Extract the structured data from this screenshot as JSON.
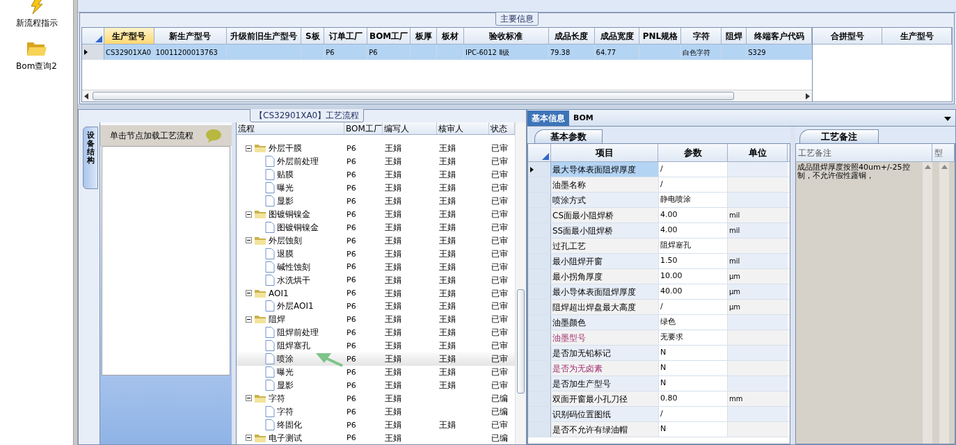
{
  "launcher": [
    {
      "kind": "bolt",
      "label": "新流程指示"
    },
    {
      "kind": "folder",
      "label": "Bom查询2"
    }
  ],
  "main_info": {
    "title": "主要信息",
    "columns": [
      {
        "label": "生产型号",
        "selected": true
      },
      {
        "label": "新生产型号",
        "selected": false
      },
      {
        "label": "升级前旧生产型号",
        "selected": false
      },
      {
        "label": "S板",
        "selected": false
      },
      {
        "label": "订单工厂",
        "selected": false
      },
      {
        "label": "BOM工厂",
        "selected": false
      },
      {
        "label": "板厚",
        "selected": false
      },
      {
        "label": "板材",
        "selected": false
      },
      {
        "label": "验收标准",
        "selected": false
      },
      {
        "label": "成品长度",
        "selected": false
      },
      {
        "label": "成品宽度",
        "selected": false
      },
      {
        "label": "PNL规格",
        "selected": false
      },
      {
        "label": "字符",
        "selected": false
      },
      {
        "label": "阻焊",
        "selected": false
      },
      {
        "label": "终端客户代码",
        "selected": false
      }
    ],
    "rows": [
      {
        "selected": true,
        "cells": [
          "CS32901XA0",
          "10011200013763",
          "",
          "",
          "P6",
          "P6",
          "",
          "",
          "IPC-6012 Ⅱ级",
          "79.38",
          "64.77",
          "",
          "白色字符",
          "",
          "S329"
        ]
      }
    ],
    "side_columns": [
      "合拼型号",
      "生产型号"
    ]
  },
  "process": {
    "title": "【CS32901XA0】工艺流程",
    "side_tab": "设备结构",
    "hint": "单击节点加载工艺流程",
    "columns": [
      "流程",
      "BOM工厂",
      "编写人",
      "核审人",
      "状态"
    ],
    "tree": [
      {
        "label": "外层干膜",
        "bom": "P6",
        "writer": "王娟",
        "reviewer": "王娟",
        "status": "已审",
        "expanded": true,
        "selected": false,
        "children": [
          {
            "label": "外层前处理",
            "bom": "P6",
            "writer": "王娟",
            "reviewer": "王娟",
            "status": "已审",
            "selected": false
          },
          {
            "label": "贴膜",
            "bom": "P6",
            "writer": "王娟",
            "reviewer": "王娟",
            "status": "已审",
            "selected": false
          },
          {
            "label": "曝光",
            "bom": "P6",
            "writer": "王娟",
            "reviewer": "王娟",
            "status": "已审",
            "selected": false
          },
          {
            "label": "显影",
            "bom": "P6",
            "writer": "王娟",
            "reviewer": "王娟",
            "status": "已审",
            "selected": false
          }
        ]
      },
      {
        "label": "图镀铜镍金",
        "bom": "P6",
        "writer": "王娟",
        "reviewer": "王娟",
        "status": "已审",
        "expanded": true,
        "selected": false,
        "children": [
          {
            "label": "图镀铜镍金",
            "bom": "P6",
            "writer": "王娟",
            "reviewer": "王娟",
            "status": "已审",
            "selected": false
          }
        ]
      },
      {
        "label": "外层蚀刻",
        "bom": "P6",
        "writer": "王娟",
        "reviewer": "王娟",
        "status": "已审",
        "expanded": true,
        "selected": false,
        "children": [
          {
            "label": "退膜",
            "bom": "P6",
            "writer": "王娟",
            "reviewer": "王娟",
            "status": "已审",
            "selected": false
          },
          {
            "label": "碱性蚀刻",
            "bom": "P6",
            "writer": "王娟",
            "reviewer": "王娟",
            "status": "已审",
            "selected": false
          },
          {
            "label": "水洗烘干",
            "bom": "P6",
            "writer": "王娟",
            "reviewer": "王娟",
            "status": "已审",
            "selected": false
          }
        ]
      },
      {
        "label": "AOI1",
        "bom": "P6",
        "writer": "王娟",
        "reviewer": "王娟",
        "status": "已审",
        "expanded": true,
        "selected": false,
        "children": [
          {
            "label": "外层AOI1",
            "bom": "P6",
            "writer": "王娟",
            "reviewer": "王娟",
            "status": "已审",
            "selected": false
          }
        ]
      },
      {
        "label": "阻焊",
        "bom": "P6",
        "writer": "王娟",
        "reviewer": "王娟",
        "status": "已审",
        "expanded": true,
        "selected": false,
        "children": [
          {
            "label": "阻焊前处理",
            "bom": "P6",
            "writer": "王娟",
            "reviewer": "王娟",
            "status": "已审",
            "selected": false
          },
          {
            "label": "阻焊塞孔",
            "bom": "P6",
            "writer": "王娟",
            "reviewer": "王娟",
            "status": "已审",
            "selected": false
          },
          {
            "label": "喷涂",
            "bom": "P6",
            "writer": "王娟",
            "reviewer": "王娟",
            "status": "已审",
            "selected": true
          },
          {
            "label": "曝光",
            "bom": "P6",
            "writer": "王娟",
            "reviewer": "王娟",
            "status": "已审",
            "selected": false
          },
          {
            "label": "显影",
            "bom": "P6",
            "writer": "王娟",
            "reviewer": "王娟",
            "status": "已审",
            "selected": false
          }
        ]
      },
      {
        "label": "字符",
        "bom": "P6",
        "writer": "王娟",
        "status": "已编",
        "expanded": true,
        "selected": false,
        "children": [
          {
            "label": "字符",
            "bom": "P6",
            "writer": "王娟",
            "status": "已编",
            "selected": false
          },
          {
            "label": "终固化",
            "bom": "P6",
            "writer": "王娟",
            "reviewer": "王娟",
            "status": "已审",
            "selected": false
          }
        ]
      },
      {
        "label": "电子测试",
        "bom": "P6",
        "writer": "王娟",
        "status": "已编",
        "expanded": true,
        "selected": false
      }
    ]
  },
  "detail": {
    "tabs": [
      {
        "label": "基本信息",
        "selected": true
      },
      {
        "label": "BOM",
        "selected": false
      }
    ],
    "params_tab": "基本参数",
    "columns": [
      "项目",
      "参数",
      "单位"
    ],
    "params": [
      {
        "item": "最大导体表面阻焊厚度",
        "value": "/",
        "selected": true,
        "kind": "normal"
      },
      {
        "item": "油墨名称",
        "value": "/",
        "selected": false,
        "kind": "normal"
      },
      {
        "item": "喷涂方式",
        "value": "静电喷涂",
        "selected": false,
        "kind": "normal"
      },
      {
        "item": "CS面最小阻焊桥",
        "value": "4.00",
        "unit": "mil",
        "selected": false,
        "kind": "normal"
      },
      {
        "item": "SS面最小阻焊桥",
        "value": "4.00",
        "unit": "mil",
        "selected": false,
        "kind": "normal"
      },
      {
        "item": "过孔工艺",
        "value": "阻焊塞孔",
        "selected": false,
        "kind": "normal"
      },
      {
        "item": "最小阻焊开窗",
        "value": "1.50",
        "unit": "mil",
        "selected": false,
        "kind": "normal"
      },
      {
        "item": "最小拐角厚度",
        "value": "10.00",
        "unit": "μm",
        "selected": false,
        "kind": "normal"
      },
      {
        "item": "最小导体表面阻焊厚度",
        "value": "40.00",
        "unit": "μm",
        "selected": false,
        "kind": "normal"
      },
      {
        "item": "阻焊超出焊盘最大高度",
        "value": "/",
        "unit": "μm",
        "selected": false,
        "kind": "normal"
      },
      {
        "item": "油墨颜色",
        "value": "绿色",
        "selected": false,
        "kind": "normal"
      },
      {
        "item": "油墨型号",
        "value": "无要求",
        "selected": false,
        "kind": "special"
      },
      {
        "item": "是否加无铅标记",
        "value": "N",
        "selected": false,
        "kind": "normal"
      },
      {
        "item": "是否为无卤素",
        "value": "N",
        "selected": false,
        "kind": "special"
      },
      {
        "item": "是否加生产型号",
        "value": "N",
        "selected": false,
        "kind": "normal"
      },
      {
        "item": "双面开窗最小孔刀径",
        "value": "0.80",
        "unit": "mm",
        "selected": false,
        "kind": "normal"
      },
      {
        "item": "识别码位置图纸",
        "value": "/",
        "selected": false,
        "kind": "normal"
      },
      {
        "item": "是否不允许有绿油帽",
        "value": "N",
        "selected": false,
        "kind": "normal"
      }
    ],
    "notes_tab": "工艺备注",
    "notes_columns": [
      "工艺备注",
      "型"
    ],
    "note": "成品阻焊厚度按照40um+/-25控制，不允许假性露铜，"
  }
}
